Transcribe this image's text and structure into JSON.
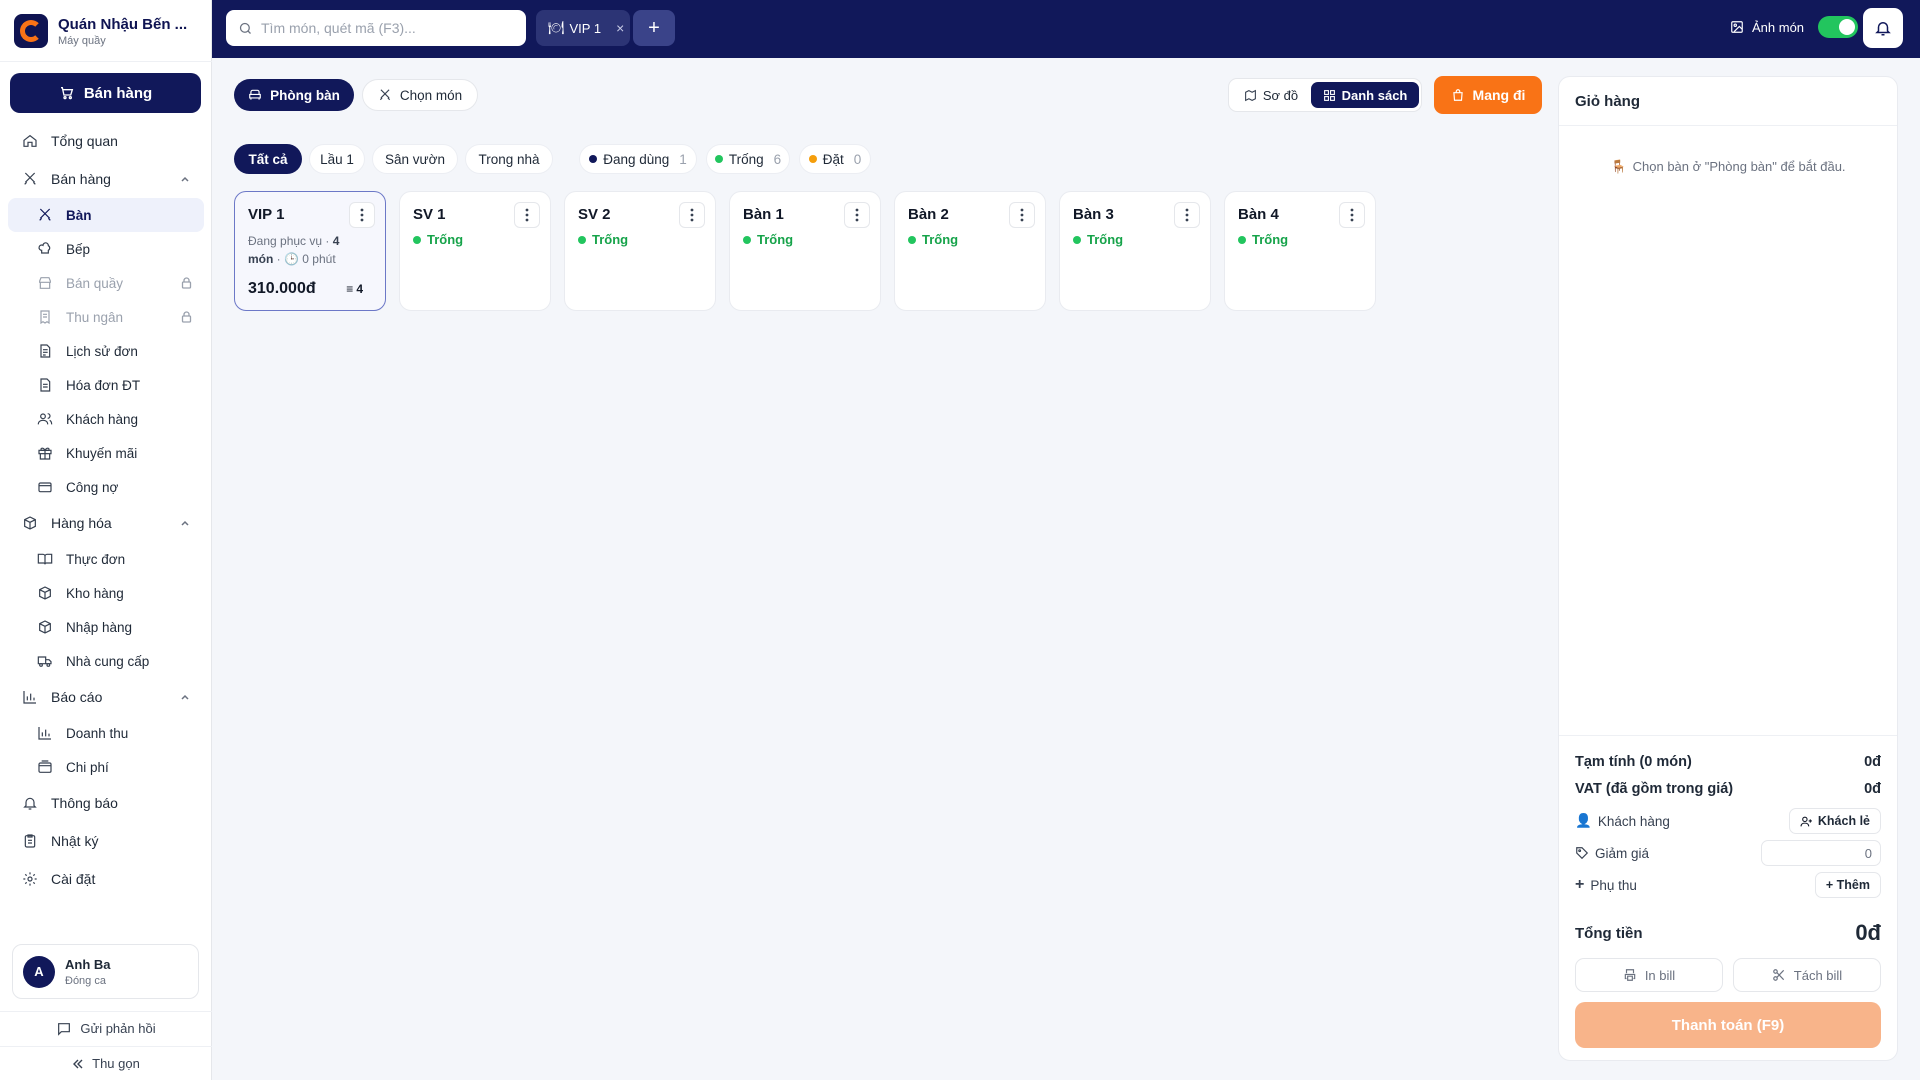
{
  "brand": {
    "name": "Quán Nhậu Bến ...",
    "sub": "Máy quầy"
  },
  "sidebar": {
    "sell_button": "Bán hàng",
    "items": {
      "overview": "Tổng quan",
      "sales_group": "Bán hàng",
      "table": "Bàn",
      "kitchen": "Bếp",
      "counter": "Bán quầy",
      "cashier": "Thu ngân",
      "order_history": "Lịch sử đơn",
      "einvoice": "Hóa đơn ĐT",
      "customers": "Khách hàng",
      "promotions": "Khuyến mãi",
      "debts": "Công nợ",
      "goods_group": "Hàng hóa",
      "menu": "Thực đơn",
      "warehouse": "Kho hàng",
      "import": "Nhập hàng",
      "suppliers": "Nhà cung cấp",
      "reports_group": "Báo cáo",
      "revenue": "Doanh thu",
      "expenses": "Chi phí",
      "notifications": "Thông báo",
      "log": "Nhật ký",
      "settings": "Cài đặt"
    },
    "user": {
      "initial": "A",
      "name": "Anh Ba",
      "status": "Đóng ca"
    },
    "feedback": "Gửi phản hồi",
    "collapse": "Thu gọn"
  },
  "topbar": {
    "search_placeholder": "Tìm món, quét mã (F3)...",
    "open_tab": "VIP 1",
    "add": "+",
    "image_toggle": "Ảnh món"
  },
  "toolbar": {
    "rooms": "Phòng bàn",
    "pick_dishes": "Chọn món",
    "view_map": "Sơ đồ",
    "view_list": "Danh sách",
    "takeaway": "Mang đi"
  },
  "filters": {
    "areas": [
      "Tất cả",
      "Lầu 1",
      "Sân vườn",
      "Trong nhà"
    ],
    "statuses": [
      {
        "label": "Đang dùng",
        "count": "1",
        "color": "#11185a"
      },
      {
        "label": "Trống",
        "count": "6",
        "color": "#22c55e"
      },
      {
        "label": "Đặt",
        "count": "0",
        "color": "#f59e0b"
      }
    ]
  },
  "tables": [
    {
      "name": "VIP 1",
      "busy": true,
      "info_prefix": "Đang phục vụ · ",
      "info_items": "4 món",
      "info_time": " · 🕒 0 phút",
      "price": "310.000đ",
      "qty": "4"
    },
    {
      "name": "SV 1",
      "status": "Trống"
    },
    {
      "name": "SV 2",
      "status": "Trống"
    },
    {
      "name": "Bàn 1",
      "status": "Trống"
    },
    {
      "name": "Bàn 2",
      "status": "Trống"
    },
    {
      "name": "Bàn 3",
      "status": "Trống"
    },
    {
      "name": "Bàn 4",
      "status": "Trống"
    }
  ],
  "cart": {
    "title": "Giỏ hàng",
    "hint": "Chọn bàn ở \"Phòng bàn\" để bắt đầu.",
    "subtotal_label": "Tạm tính (0 món)",
    "subtotal_value": "0đ",
    "vat_label": "VAT (đã gồm trong giá)",
    "vat_value": "0đ",
    "customer_label": "Khách hàng",
    "customer_button": "Khách lẻ",
    "discount_label": "Giảm giá",
    "discount_value": "0",
    "surcharge_label": "Phụ thu",
    "surcharge_button": "+ Thêm",
    "total_label": "Tổng tiền",
    "total_value": "0đ",
    "print_bill": "In bill",
    "split_bill": "Tách bill",
    "pay": "Thanh toán (F9)"
  },
  "colors": {
    "navy": "#11185a",
    "orange": "#f97316",
    "green": "#22c55e"
  }
}
